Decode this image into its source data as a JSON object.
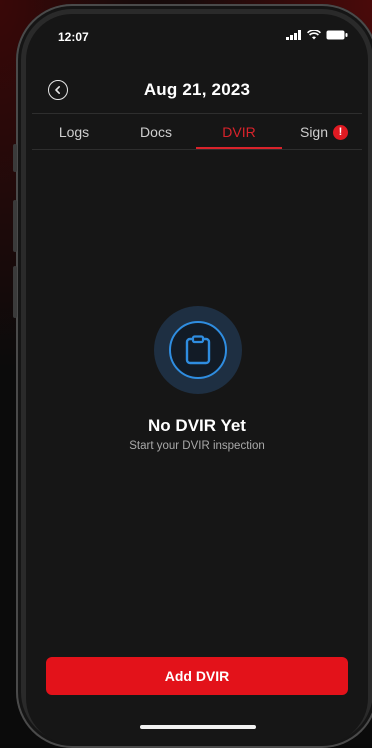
{
  "status_bar": {
    "time": "12:07",
    "icons": [
      "signal-icon",
      "wifi-icon",
      "battery-icon"
    ]
  },
  "header": {
    "back_icon": "back-circle-icon",
    "title": "Aug 21, 2023"
  },
  "tabs": [
    {
      "label": "Logs",
      "active": false
    },
    {
      "label": "Docs",
      "active": false
    },
    {
      "label": "DVIR",
      "active": true
    },
    {
      "label": "Sign",
      "active": false,
      "alert": "!"
    }
  ],
  "empty_state": {
    "icon": "clipboard-icon",
    "title": "No DVIR Yet",
    "subtitle": "Start your DVIR inspection"
  },
  "actions": {
    "add_label": "Add DVIR"
  },
  "colors": {
    "accent": "#e3121a",
    "active_tab": "#d9232b",
    "icon_blue": "#2f8de0",
    "screen_bg": "#161616"
  }
}
